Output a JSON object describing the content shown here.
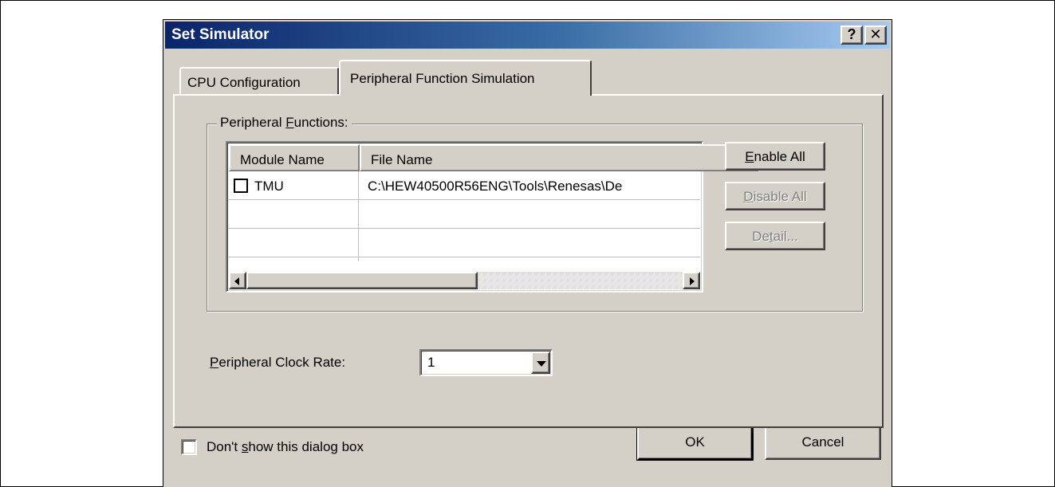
{
  "dialog": {
    "title": "Set Simulator",
    "help_glyph": "?",
    "close_glyph": "✕"
  },
  "tabs": [
    {
      "label": "CPU Configuration",
      "active": false
    },
    {
      "label": "Peripheral Function Simulation",
      "active": true
    }
  ],
  "peripheral_functions": {
    "group_label_pre": "Peripheral ",
    "group_label_mnemonic": "F",
    "group_label_post": "unctions:",
    "columns": [
      "Module Name",
      "File Name"
    ],
    "rows": [
      {
        "module": "TMU",
        "checked": false,
        "file": "C:\\HEW40500R56ENG\\Tools\\Renesas\\De"
      }
    ]
  },
  "side_buttons": {
    "enable_all": {
      "mnemonic": "E",
      "rest": "nable All",
      "enabled": true
    },
    "disable_all": {
      "mnemonic": "D",
      "rest": "isable All",
      "enabled": false
    },
    "detail": {
      "pre": "De",
      "mnemonic": "t",
      "rest": "ail...",
      "enabled": false
    }
  },
  "clock_rate": {
    "label_mnemonic": "P",
    "label_rest": "eripheral Clock Rate:",
    "value": "1"
  },
  "footer": {
    "dont_show_pre": "Don't ",
    "dont_show_mnemonic": "s",
    "dont_show_post": "how this dialog box",
    "dont_show_checked": false,
    "ok_label": "OK",
    "cancel_label": "Cancel"
  },
  "colors": {
    "title_gradient_start": "#0a246a",
    "title_gradient_end": "#a6caf0",
    "face": "#d4d0c8",
    "disabled_text": "#808080"
  }
}
